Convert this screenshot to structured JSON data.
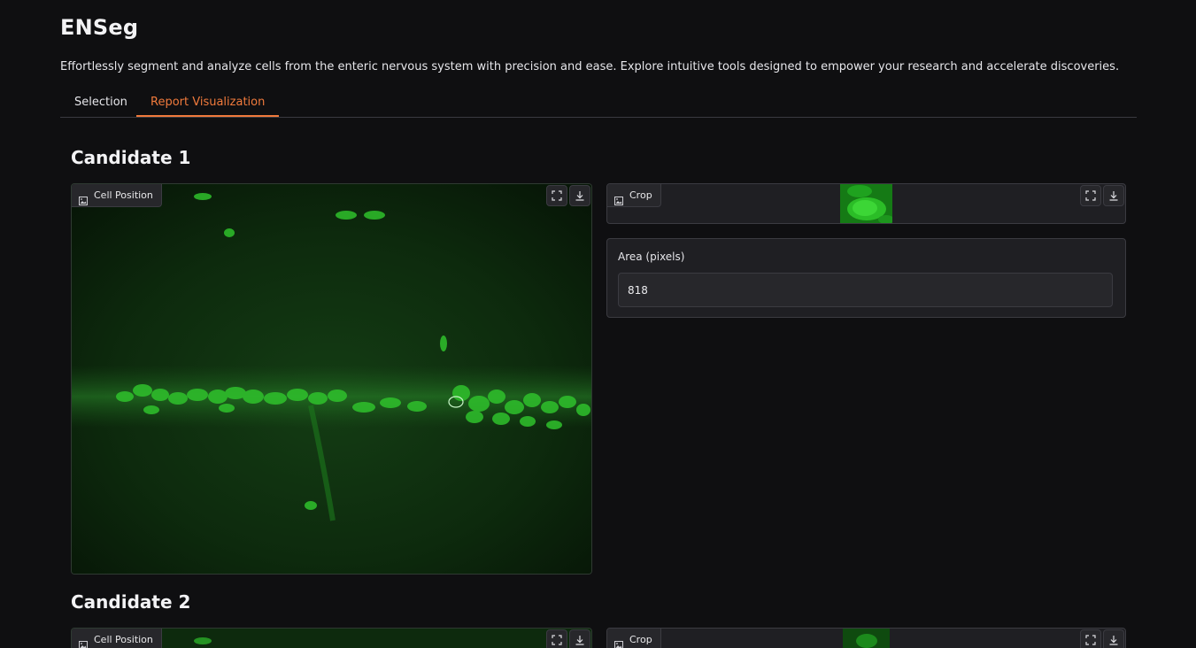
{
  "app": {
    "title": "ENSeg",
    "description": "Effortlessly segment and analyze cells from the enteric nervous system with precision and ease. Explore intuitive tools designed to empower your research and accelerate discoveries."
  },
  "tabs": [
    {
      "label": "Selection",
      "active": false
    },
    {
      "label": "Report Visualization",
      "active": true
    }
  ],
  "colors": {
    "accent": "#f07a3c",
    "background": "#0f0f11",
    "cell_green": "#22c11f"
  },
  "candidates": [
    {
      "title": "Candidate 1",
      "cell_position_label": "Cell Position",
      "crop_label": "Crop",
      "area_label": "Area (pixels)",
      "area_value": "818"
    },
    {
      "title": "Candidate 2",
      "cell_position_label": "Cell Position",
      "crop_label": "Crop"
    }
  ],
  "icons": {
    "image": "image-icon",
    "fullscreen": "fullscreen-icon",
    "download": "download-icon"
  }
}
